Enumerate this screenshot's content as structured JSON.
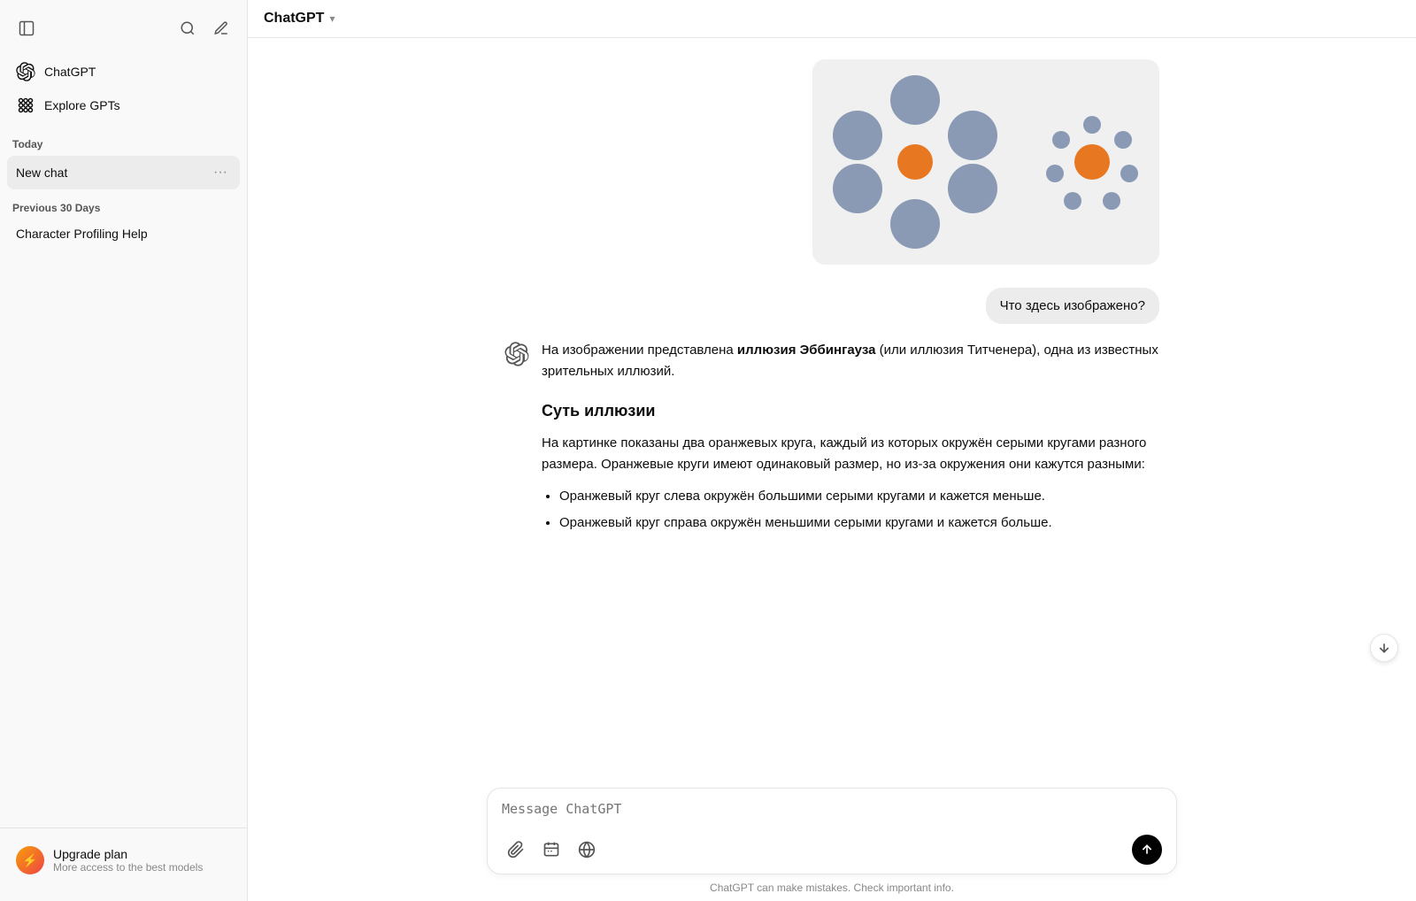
{
  "sidebar": {
    "toggle_label": "Toggle sidebar",
    "search_label": "Search",
    "new_chat_label": "New chat",
    "nav_items": [
      {
        "id": "chatgpt",
        "label": "ChatGPT",
        "icon": "chatgpt-icon"
      },
      {
        "id": "explore",
        "label": "Explore GPTs",
        "icon": "grid-icon"
      }
    ],
    "section_today": "Today",
    "section_previous": "Previous 30 Days",
    "today_chats": [
      {
        "id": "new-chat",
        "label": "New chat",
        "active": true
      }
    ],
    "previous_chats": [
      {
        "id": "char-profiling",
        "label": "Character Profiling Help",
        "active": false
      }
    ],
    "upgrade": {
      "title": "Upgrade plan",
      "subtitle": "More access to the best models"
    }
  },
  "header": {
    "title": "ChatGPT",
    "chevron": "▾"
  },
  "chat": {
    "user_question": "Что здесь изображено?",
    "ai_response": {
      "intro": "На изображении представлена",
      "bold_name": "иллюзия Эббингауза",
      "intro_cont": " (или иллюзия Титченера), одна из известных зрительных иллюзий.",
      "section_title": "Суть иллюзии",
      "para1": "На картинке показаны два оранжевых круга, каждый из которых окружён серыми кругами разного размера. Оранжевые круги имеют одинаковый размер, но из-за окружения они кажутся разными:",
      "bullet1": "Оранжевый круг слева окружён большими серыми кругами и кажется меньше.",
      "bullet2": "Оранжевый круг справа окружён меньшими серыми кругами и кажется больше."
    }
  },
  "input": {
    "placeholder": "Message ChatGPT"
  },
  "disclaimer": "ChatGPT can make mistakes. Check important info."
}
